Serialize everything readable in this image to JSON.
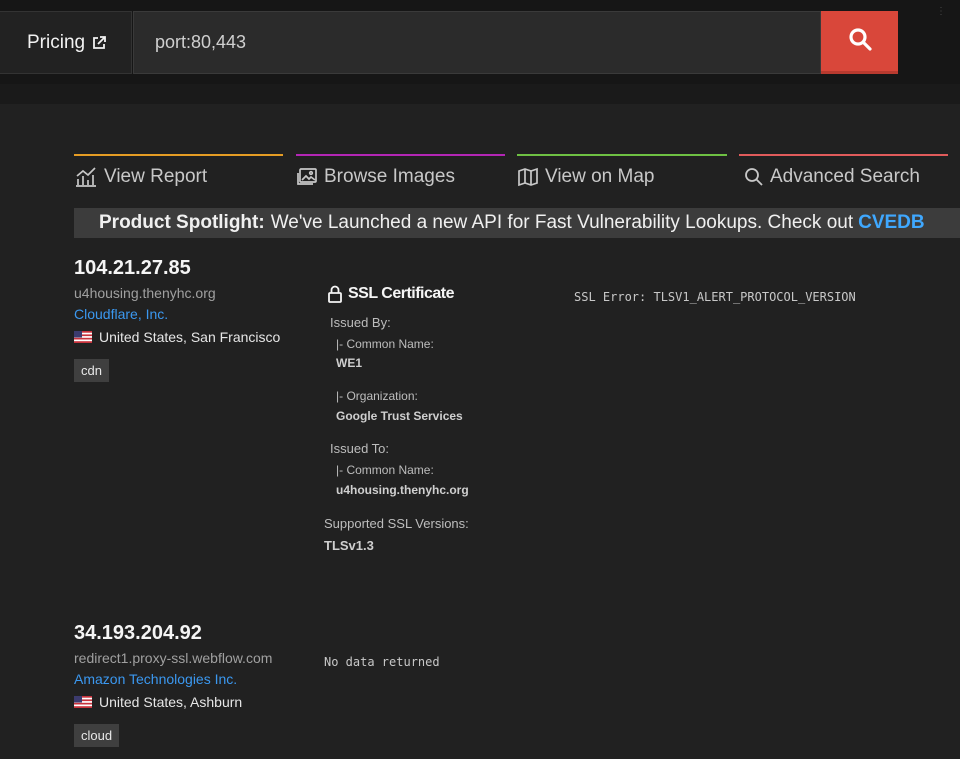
{
  "header": {
    "pricing_label": "Pricing",
    "search_value": "port:80,443"
  },
  "tabs": {
    "view_report": "View Report",
    "browse_images": "Browse Images",
    "view_on_map": "View on Map",
    "advanced_search": "Advanced Search"
  },
  "spotlight": {
    "label": "Product Spotlight:",
    "text": "We've Launched a new API for Fast Vulnerability Lookups. Check out",
    "link": "CVEDB"
  },
  "results": [
    {
      "ip": "104.21.27.85",
      "hostname": "u4housing.thenyhc.org",
      "org": "Cloudflare, Inc.",
      "location": "United States, San Francisco",
      "tag": "cdn",
      "ssl": {
        "title": "SSL Certificate",
        "issued_by_label": "Issued By:",
        "issuer_cn_label": "|- Common Name:",
        "issuer_cn": "WE1",
        "issuer_org_label": "|- Organization:",
        "issuer_org": "Google Trust Services",
        "issued_to_label": "Issued To:",
        "subject_cn_label": "|- Common Name:",
        "subject_cn": "u4housing.thenyhc.org",
        "versions_label": "Supported SSL Versions:",
        "versions": "TLSv1.3"
      },
      "banner": "SSL Error: TLSV1_ALERT_PROTOCOL_VERSION"
    },
    {
      "ip": "34.193.204.92",
      "hostname": "redirect1.proxy-ssl.webflow.com",
      "org": "Amazon Technologies Inc.",
      "location": "United States, Ashburn",
      "tag": "cloud",
      "banner": "No data returned"
    }
  ],
  "colors": {
    "accent_search": "#d9473a",
    "link": "#3b98f0",
    "tab_report": "#e59c24",
    "tab_images": "#b326b5",
    "tab_map": "#6ec043",
    "tab_advanced": "#e05b5b"
  }
}
